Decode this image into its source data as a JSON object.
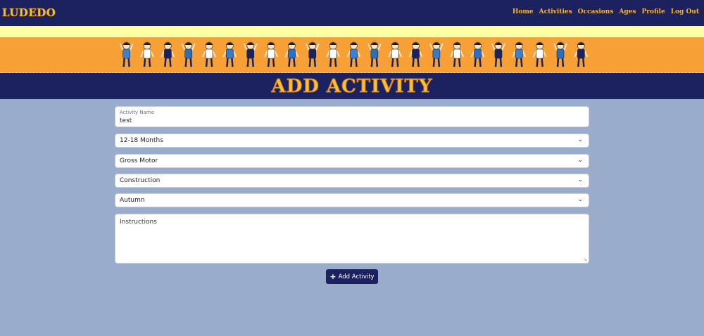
{
  "brand": "LUDEDO",
  "nav": {
    "items": [
      {
        "label": "Home"
      },
      {
        "label": "Activities"
      },
      {
        "label": "Occasions"
      },
      {
        "label": "Ages"
      },
      {
        "label": "Profile"
      },
      {
        "label": "Log Out"
      }
    ]
  },
  "page_title": "ADD ACTIVITY",
  "form": {
    "activity_name_label": "Activity Name",
    "activity_name_value": "test",
    "age_select": "12-18 Months",
    "skill_select": "Gross Motor",
    "type_select": "Construction",
    "season_select": "Autumn",
    "instructions_placeholder": "Instructions",
    "submit_label": "Add Activity"
  },
  "colors": {
    "navy": "#1c2260",
    "orange": "#f6a036",
    "yellow": "#fefea4",
    "background": "#9aaccc",
    "title_gold": "#f7c432"
  },
  "icons": {
    "select_chevron": "chevron-down-icon",
    "submit_icon": "plus-icon"
  }
}
